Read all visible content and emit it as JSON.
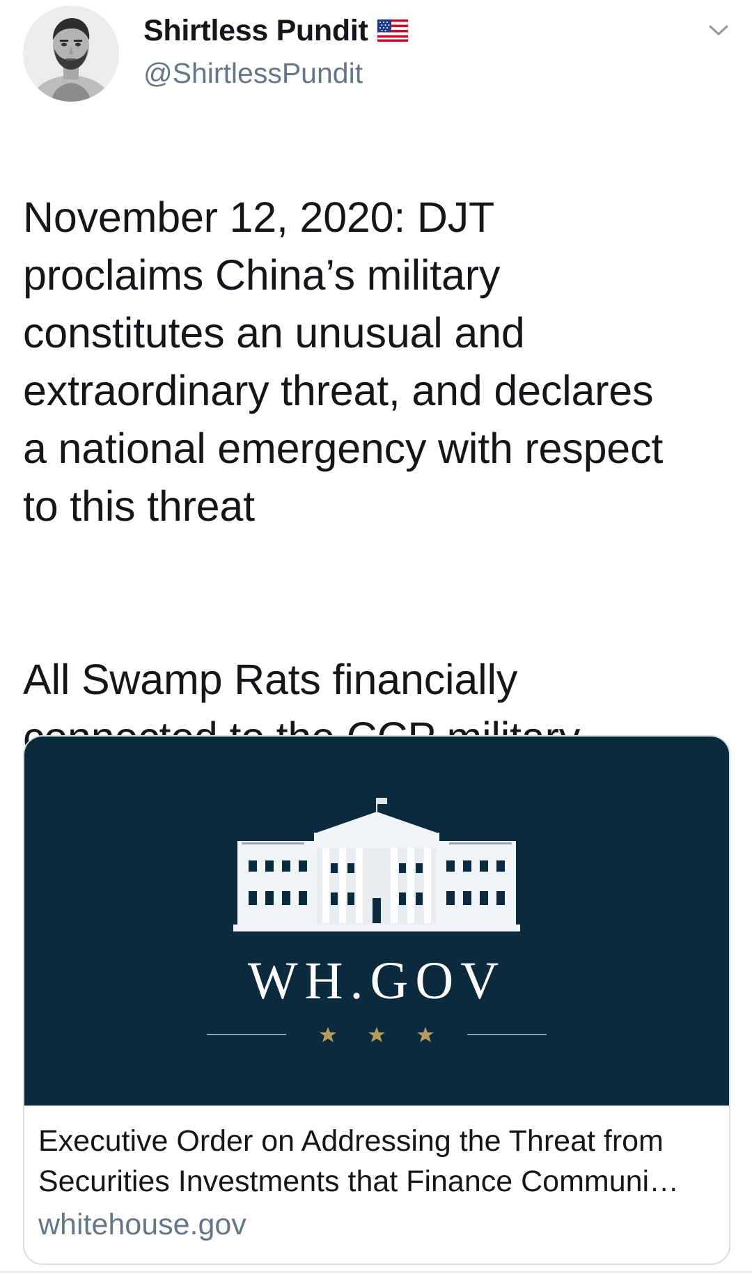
{
  "author": {
    "display_name": "Shirtless Pundit",
    "handle": "@ShirtlessPundit",
    "badge_icon": "us-flag-icon",
    "avatar_icon": "avatar-photo"
  },
  "menu": {
    "icon": "chevron-down-icon"
  },
  "tweet": {
    "paragraph_1": "November 12, 2020: DJT\nproclaims China’s military\nconstitutes an unusual and\nextraordinary threat, and declares\na national emergency with respect\nto this threat",
    "paragraph_2": "All Swamp Rats financially\nconnected to the CCP military\nhave been given their final notice"
  },
  "card": {
    "image_label": "WH.GOV",
    "image_icon": "white-house-logo",
    "title_line_1": "Executive Order on Addressing the Threat from",
    "title_line_2": "Securities Investments that Finance Communi…",
    "domain": "whitehouse.gov"
  },
  "colors": {
    "text_primary": "#14171a",
    "text_secondary": "#657786",
    "card_image_bg": "#0b2a3e",
    "card_border": "#d6dde3",
    "star_gold": "#b59b5e"
  }
}
